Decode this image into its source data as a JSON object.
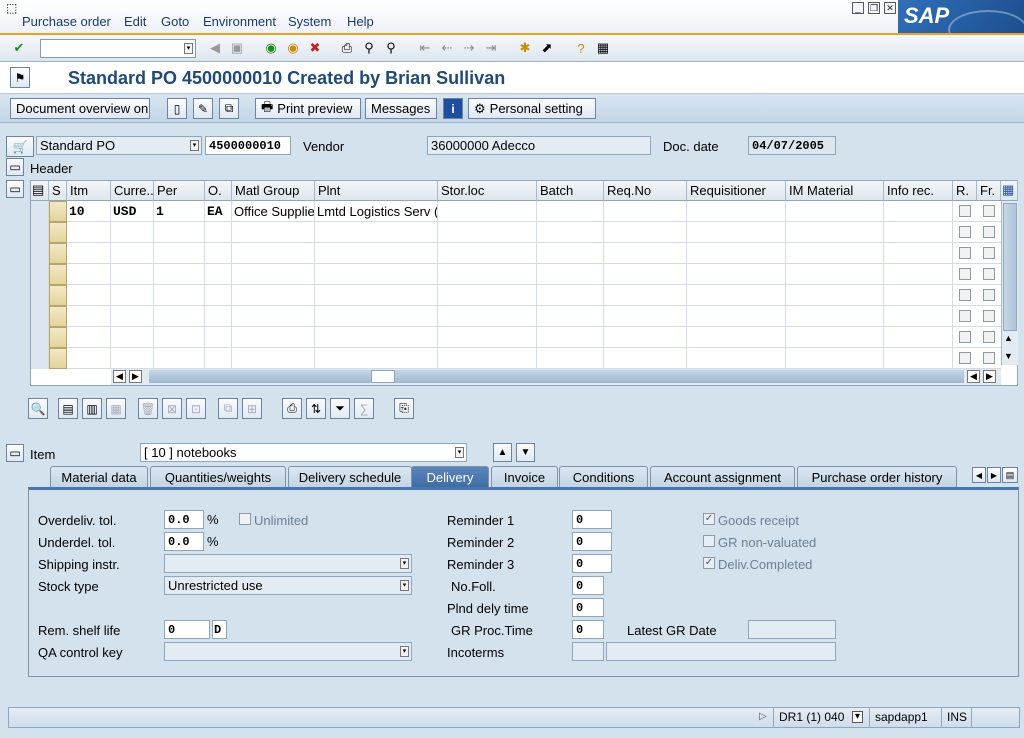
{
  "menu": {
    "items": [
      "Purchase order",
      "Edit",
      "Goto",
      "Environment",
      "System",
      "Help"
    ]
  },
  "logo": {
    "text": "SAP"
  },
  "title": "Standard PO 4500000010 Created by Brian Sullivan",
  "app_toolbar": {
    "doc_overview": "Document overview on",
    "print_preview": "Print preview",
    "messages": "Messages",
    "personal_setting": "Personal setting"
  },
  "header": {
    "po_type": "Standard PO",
    "po_number": "4500000010",
    "vendor_label": "Vendor",
    "vendor_value": "36000000 Adecco",
    "doc_date_label": "Doc. date",
    "doc_date_value": "04/07/2005",
    "header_label": "Header"
  },
  "grid": {
    "columns": [
      "S",
      "Itm",
      "Curre...",
      "Per",
      "O.",
      "Matl Group",
      "Plnt",
      "Stor.loc",
      "Batch",
      "Req.No",
      "Requisitioner",
      "IM Material",
      "Info rec.",
      "R.",
      "Fr."
    ],
    "row1": {
      "itm": "10",
      "curr": "USD",
      "per": "1",
      "o": "EA",
      "matl_group": "Office Supplie:",
      "plnt": "Lmtd Logistics Serv ("
    }
  },
  "item": {
    "label": "Item",
    "value": "[ 10 ] notebooks"
  },
  "tabs": [
    "Material data",
    "Quantities/weights",
    "Delivery schedule",
    "Delivery",
    "Invoice",
    "Conditions",
    "Account assignment",
    "Purchase order history"
  ],
  "delivery": {
    "overdeliv_label": "Overdeliv. tol.",
    "overdeliv_value": "0.0",
    "underdel_label": "Underdel. tol.",
    "underdel_value": "0.0",
    "pct": "%",
    "unlimited": "Unlimited",
    "shipping_label": "Shipping instr.",
    "stock_label": "Stock type",
    "stock_value": "Unrestricted use",
    "shelf_label": "Rem. shelf life",
    "shelf_value": "0",
    "shelf_unit": "D",
    "qa_label": "QA control key",
    "rem1_label": "Reminder 1",
    "rem1": "0",
    "rem2_label": "Reminder 2",
    "rem2": "0",
    "rem3_label": "Reminder 3",
    "rem3": "0",
    "nofoll_label": "No.Foll.",
    "nofoll": "0",
    "plnd_label": "Plnd dely time",
    "plnd": "0",
    "grproc_label": "GR Proc.Time",
    "grproc": "0",
    "incoterms_label": "Incoterms",
    "latest_gr_label": "Latest GR Date",
    "goods_receipt": "Goods receipt",
    "gr_nonvalued": "GR non-valuated",
    "deliv_completed": "Deliv.Completed"
  },
  "status": {
    "system": "DR1 (1) 040",
    "server": "sapdapp1",
    "mode": "INS"
  }
}
